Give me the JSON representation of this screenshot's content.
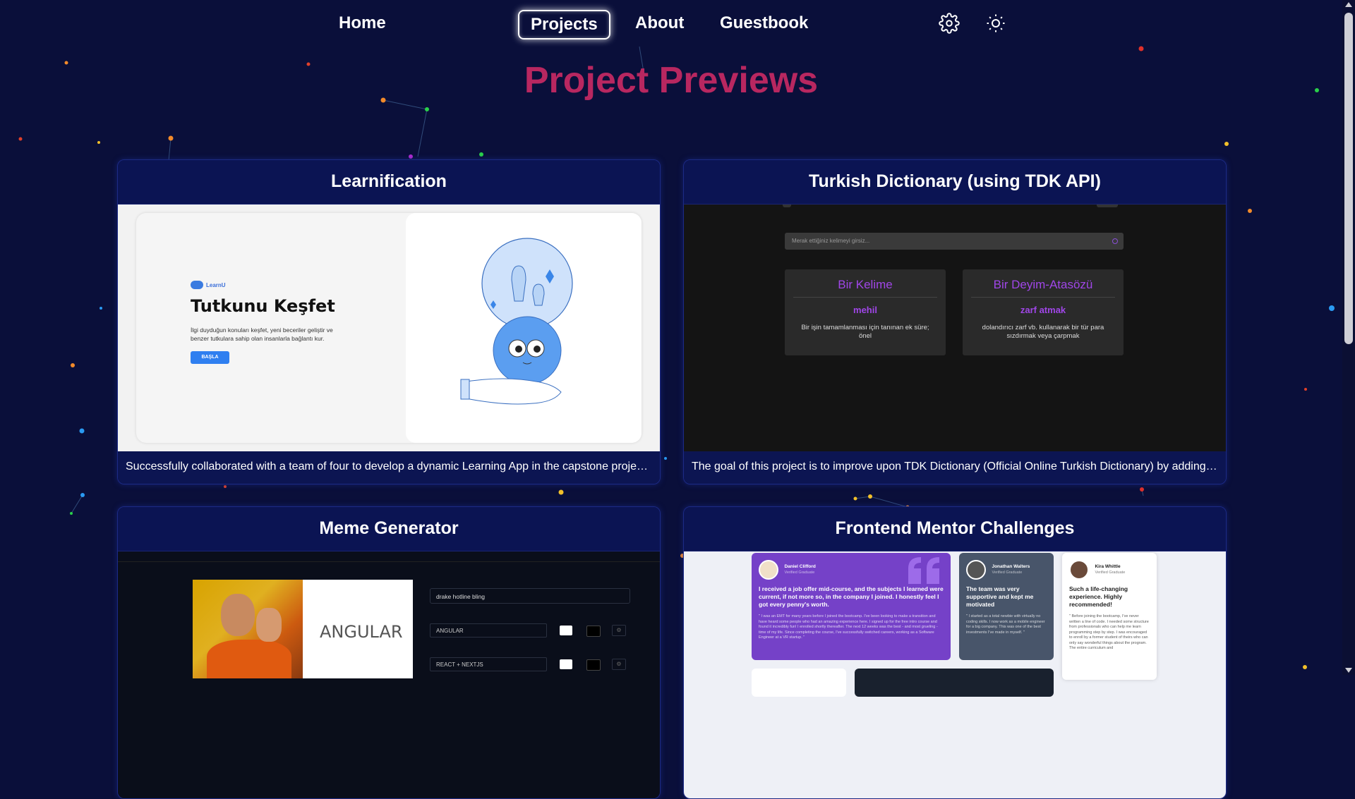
{
  "nav": {
    "home": "Home",
    "projects": "Projects",
    "about": "About",
    "guestbook": "Guestbook",
    "settings_icon": "gear-icon",
    "theme_icon": "sun-icon"
  },
  "page_title": "Project Previews",
  "cards": [
    {
      "title": "Learnification",
      "description": "Successfully collaborated with a team of four to develop a dynamic Learning App in the capstone project of the bootcamp.",
      "preview": {
        "logo": "LearnU",
        "heading": "Tutkunu Keşfet",
        "text": "İlgi duyduğun konuları keşfet, yeni beceriler geliştir ve benzer tutkulara sahip olan insanlarla bağlantı kur.",
        "button": "BAŞLA"
      }
    },
    {
      "title": "Turkish Dictionary (using TDK API)",
      "description": "The goal of this project is to improve upon TDK Dictionary (Official Online Turkish Dictionary) by adding new features.",
      "preview": {
        "search_placeholder": "Merak ettiğiniz kelimeyi girsiz...",
        "box1_title": "Bir Kelime",
        "box1_word": "mehil",
        "box1_desc": "Bir işin tamamlanması için tanınan ek süre; önel",
        "box2_title": "Bir Deyim-Atasözü",
        "box2_word": "zarf atmak",
        "box2_desc": "dolandırıcı zarf vb. kullanarak bir tür para sızdırmak veya çarpmak"
      }
    },
    {
      "title": "Meme Generator",
      "preview": {
        "meme_label": "ANGULAR",
        "template_select": "drake hotline bling",
        "line1": "ANGULAR",
        "line2": "REACT + NEXTJS"
      }
    },
    {
      "title": "Frontend Mentor Challenges",
      "preview": {
        "t1_name": "Daniel Clifford",
        "t1_role": "Verified Graduate",
        "t1_head": "I received a job offer mid-course, and the subjects I learned were current, if not more so, in the company I joined. I honestly feel I got every penny's worth.",
        "t1_body": "\" I was an EMT for many years before I joined the bootcamp. I've been looking to make a transition and have heard some people who had an amazing experience here. I signed up for the free intro course and found it incredibly fun! I enrolled shortly thereafter. The next 12 weeks was the best - and most grueling - time of my life. Since completing the course, I've successfully switched careers, working as a Software Engineer at a VR startup. \"",
        "t2_name": "Jonathan Walters",
        "t2_role": "Verified Graduate",
        "t2_head": "The team was very supportive and kept me motivated",
        "t2_body": "\" I started as a total newbie with virtually no coding skills. I now work as a mobile engineer for a big company. This was one of the best investments I've made in myself. \"",
        "t3_name": "Kira Whittle",
        "t3_role": "Verified Graduate",
        "t3_head": "Such a life-changing experience. Highly recommended!",
        "t3_body": "\" Before joining the bootcamp, I've never written a line of code. I needed some structure from professionals who can help me learn programming step by step. I was encouraged to enroll by a former student of theirs who can only say wonderful things about the program. The entire curriculum and"
      }
    }
  ],
  "colors": {
    "background": "#0a0f3a",
    "title": "#b82760",
    "card": "#0c1552"
  }
}
